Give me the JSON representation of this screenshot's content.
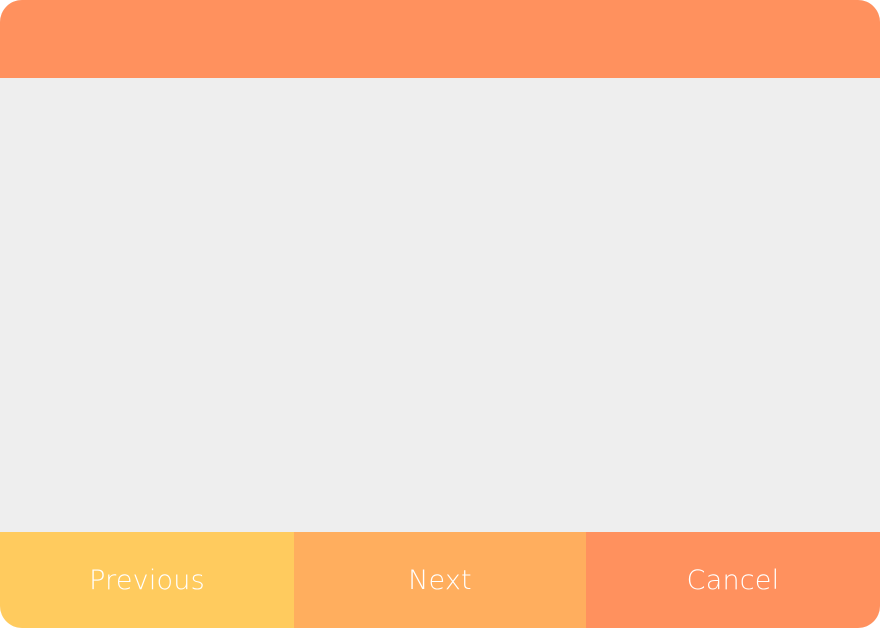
{
  "footer": {
    "previous_label": "Previous",
    "next_label": "Next",
    "cancel_label": "Cancel"
  },
  "colors": {
    "header": "#ff915e",
    "content_background": "#eeeeee",
    "previous_button": "#ffcb5e",
    "next_button": "#ffae5e",
    "cancel_button": "#ff915e",
    "button_text": "#ffffff"
  }
}
